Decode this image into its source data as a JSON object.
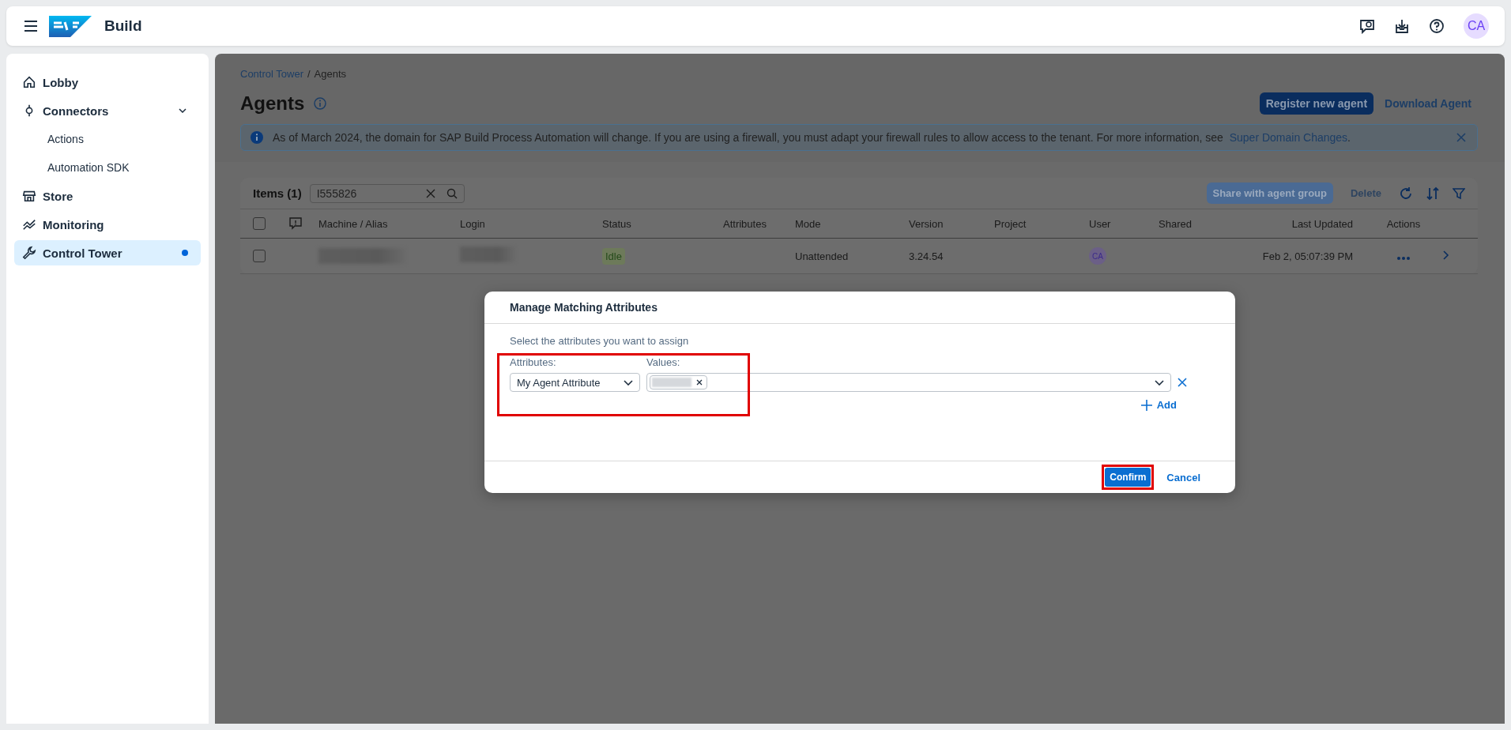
{
  "header": {
    "product": "Build",
    "avatar": "CA"
  },
  "sidebar": {
    "items": [
      {
        "label": "Lobby",
        "selected": false
      },
      {
        "label": "Connectors",
        "selected": false,
        "expanded": true,
        "children": [
          {
            "label": "Actions",
            "selected": false
          },
          {
            "label": "Automation SDK",
            "selected": false
          }
        ]
      },
      {
        "label": "Store",
        "selected": false
      },
      {
        "label": "Monitoring",
        "selected": false
      },
      {
        "label": "Control Tower",
        "selected": true,
        "notification": true
      }
    ]
  },
  "breadcrumb": [
    {
      "label": "Control Tower",
      "kind": "link"
    },
    {
      "label": "/",
      "kind": "separator"
    },
    {
      "label": "Agents",
      "kind": "current"
    }
  ],
  "page": {
    "title": "Agents",
    "buttons": [
      {
        "label": "Register new agent",
        "kind": "primary"
      },
      {
        "label": "Download Agent",
        "kind": "link"
      }
    ]
  },
  "banner": {
    "text": "As of March 2024, the domain for SAP Build Process Automation will change. If you are using a firewall, you must adapt your firewall rules to allow access to the tenant. For more information, see",
    "link": "Super Domain Changes",
    "suffix": "."
  },
  "table": {
    "items_label": "Items (1)",
    "search_value": "I555826",
    "all_selected": false,
    "toolbar": [
      {
        "label": "Share with agent group",
        "kind": "primary",
        "disabled": true
      },
      {
        "label": "Delete",
        "kind": "text",
        "disabled": true
      }
    ],
    "columns": [
      "Machine / Alias",
      "Login",
      "Status",
      "Attributes",
      "Mode",
      "Version",
      "Project",
      "User",
      "Shared",
      "Last Updated",
      "Actions"
    ],
    "rows": [
      {
        "selected": false,
        "status": "Idle",
        "mode": "Unattended",
        "version": "3.24.54",
        "user": "CA",
        "last_updated": "Feb 2, 05:07:39 PM"
      }
    ]
  },
  "dialog": {
    "title": "Manage Matching Attributes",
    "instruction": "Select the attributes you want to assign",
    "attributes_label": "Attributes:",
    "values_label": "Values:",
    "rows": [
      {
        "attribute": "My Agent Attribute"
      }
    ],
    "add": "Add",
    "buttons": [
      {
        "label": "Confirm",
        "kind": "primary",
        "highlighted": true
      },
      {
        "label": "Cancel",
        "kind": "link",
        "highlighted": false
      }
    ]
  }
}
